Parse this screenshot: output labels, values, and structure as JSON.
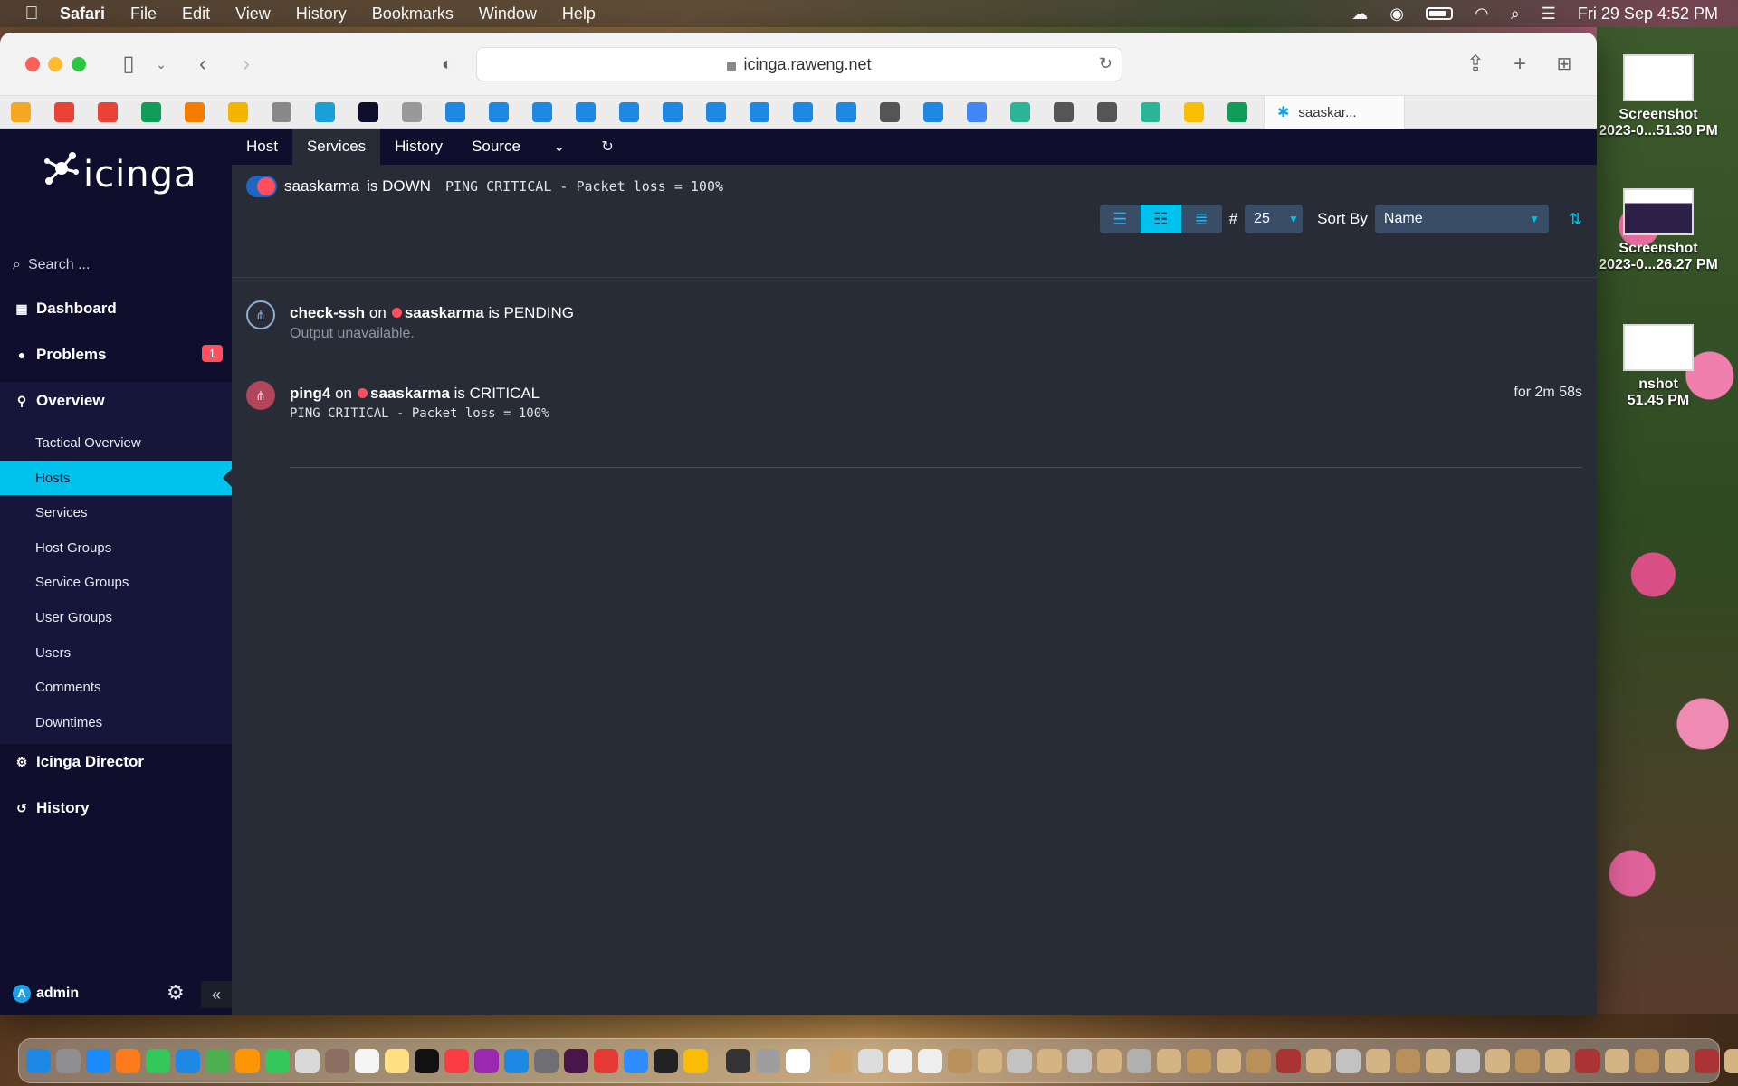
{
  "menubar": {
    "app": "Safari",
    "items": [
      "File",
      "Edit",
      "View",
      "History",
      "Bookmarks",
      "Window",
      "Help"
    ],
    "datetime": "Fri 29 Sep  4:52 PM"
  },
  "desktop": {
    "icons": [
      {
        "label1": "Screenshot",
        "label2": "2023-0...51.30 PM"
      },
      {
        "label1": "Screenshot",
        "label2": "2023-0...26.27 PM"
      },
      {
        "label1": "nshot",
        "label2": "51.45 PM"
      }
    ]
  },
  "browser": {
    "url": "icinga.raweng.net",
    "active_tab": "saaskar..."
  },
  "icinga": {
    "logo": "icinga",
    "search_placeholder": "Search ...",
    "nav": {
      "dashboard": "Dashboard",
      "problems": "Problems",
      "problems_count": "1",
      "overview": "Overview",
      "director": "Icinga Director",
      "history": "History"
    },
    "overview_items": [
      "Tactical Overview",
      "Hosts",
      "Services",
      "Host Groups",
      "Service Groups",
      "User Groups",
      "Users",
      "Comments",
      "Downtimes"
    ],
    "user": "admin",
    "tabs": [
      "Host",
      "Services",
      "History",
      "Source"
    ],
    "host": {
      "name": "saaskarma",
      "state_text": "is DOWN",
      "output": "PING CRITICAL - Packet loss = 100%"
    },
    "controls": {
      "limit_label": "#",
      "limit_value": "25",
      "sort_label": "Sort By",
      "sort_value": "Name"
    },
    "services": [
      {
        "name": "check-ssh",
        "on": "on",
        "host": "saaskarma",
        "state": "is PENDING",
        "output": "Output unavailable.",
        "time": "",
        "status": "pending"
      },
      {
        "name": "ping4",
        "on": "on",
        "host": "saaskarma",
        "state": "is CRITICAL",
        "output": "PING CRITICAL - Packet loss = 100%",
        "time": "for 2m 58s",
        "status": "critical"
      }
    ]
  },
  "colors": {
    "sidebar_bg": "#0f0f2d",
    "main_bg": "#282c37",
    "accent": "#00c3ed",
    "critical": "#ff4f5e"
  }
}
